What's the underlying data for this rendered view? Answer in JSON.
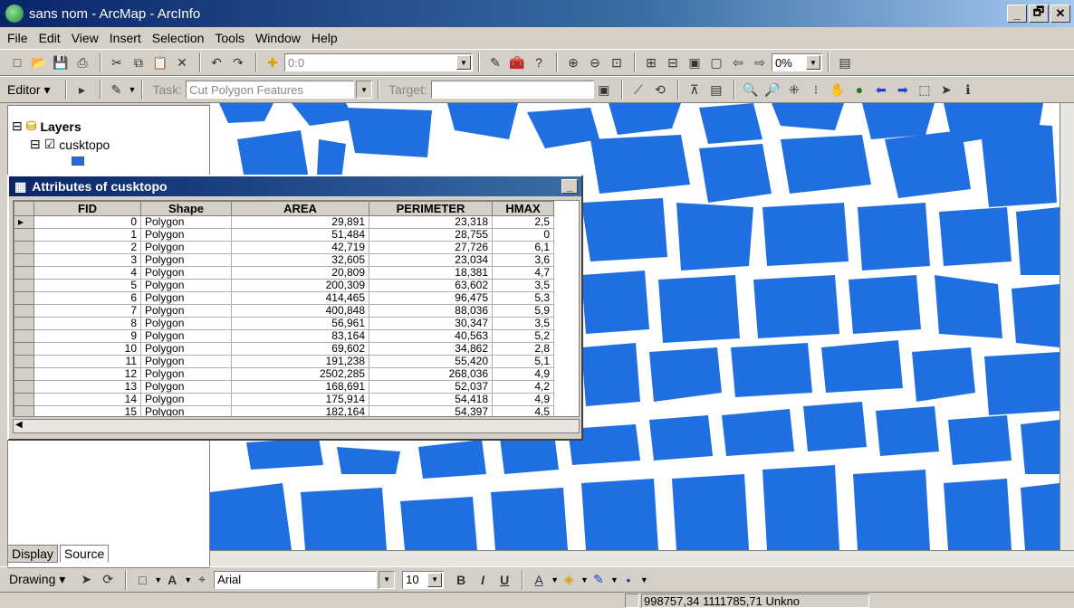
{
  "window": {
    "title": "sans nom - ArcMap - ArcInfo",
    "min": "_",
    "max": "🗗",
    "close": "✕"
  },
  "menu": [
    "File",
    "Edit",
    "View",
    "Insert",
    "Selection",
    "Tools",
    "Window",
    "Help"
  ],
  "toolbar1": {
    "scale_value": "0:0",
    "zoom_value": "0%"
  },
  "editor": {
    "editor_label": "Editor ▾",
    "task_label": "Task:",
    "task_value": "Cut Polygon Features",
    "target_label": "Target:"
  },
  "toc": {
    "layers_label": "Layers",
    "layer_name": "cusktopo",
    "tabs": [
      "Display",
      "Source"
    ]
  },
  "attributes": {
    "title": "Attributes of cusktopo",
    "columns": [
      "FID",
      "Shape",
      "AREA",
      "PERIMETER",
      "HMAX"
    ],
    "rows": [
      [
        "0",
        "Polygon",
        "29,891",
        "23,318",
        "2,5"
      ],
      [
        "1",
        "Polygon",
        "51,484",
        "28,755",
        "0"
      ],
      [
        "2",
        "Polygon",
        "42,719",
        "27,726",
        "6,1"
      ],
      [
        "3",
        "Polygon",
        "32,605",
        "23,034",
        "3,6"
      ],
      [
        "4",
        "Polygon",
        "20,809",
        "18,381",
        "4,7"
      ],
      [
        "5",
        "Polygon",
        "200,309",
        "63,602",
        "3,5"
      ],
      [
        "6",
        "Polygon",
        "414,465",
        "96,475",
        "5,3"
      ],
      [
        "7",
        "Polygon",
        "400,848",
        "88,036",
        "5,9"
      ],
      [
        "8",
        "Polygon",
        "56,961",
        "30,347",
        "3,5"
      ],
      [
        "9",
        "Polygon",
        "83,164",
        "40,563",
        "5,2"
      ],
      [
        "10",
        "Polygon",
        "69,602",
        "34,862",
        "2,8"
      ],
      [
        "11",
        "Polygon",
        "191,238",
        "55,420",
        "5,1"
      ],
      [
        "12",
        "Polygon",
        "2502,285",
        "268,036",
        "4,9"
      ],
      [
        "13",
        "Polygon",
        "168,691",
        "52,037",
        "4,2"
      ],
      [
        "14",
        "Polygon",
        "175,914",
        "54,418",
        "4,9"
      ],
      [
        "15",
        "Polygon",
        "182,164",
        "54,397",
        "4,5"
      ]
    ]
  },
  "drawing": {
    "drawing_label": "Drawing ▾",
    "font_name": "Arial",
    "font_size": "10",
    "bold": "B",
    "italic": "I",
    "underline": "U"
  },
  "status": {
    "coords": "998757,34  1111785,71 Unkno"
  },
  "colors": {
    "map_fill": "#1f6fe0",
    "title_bar": "#0a246a"
  }
}
